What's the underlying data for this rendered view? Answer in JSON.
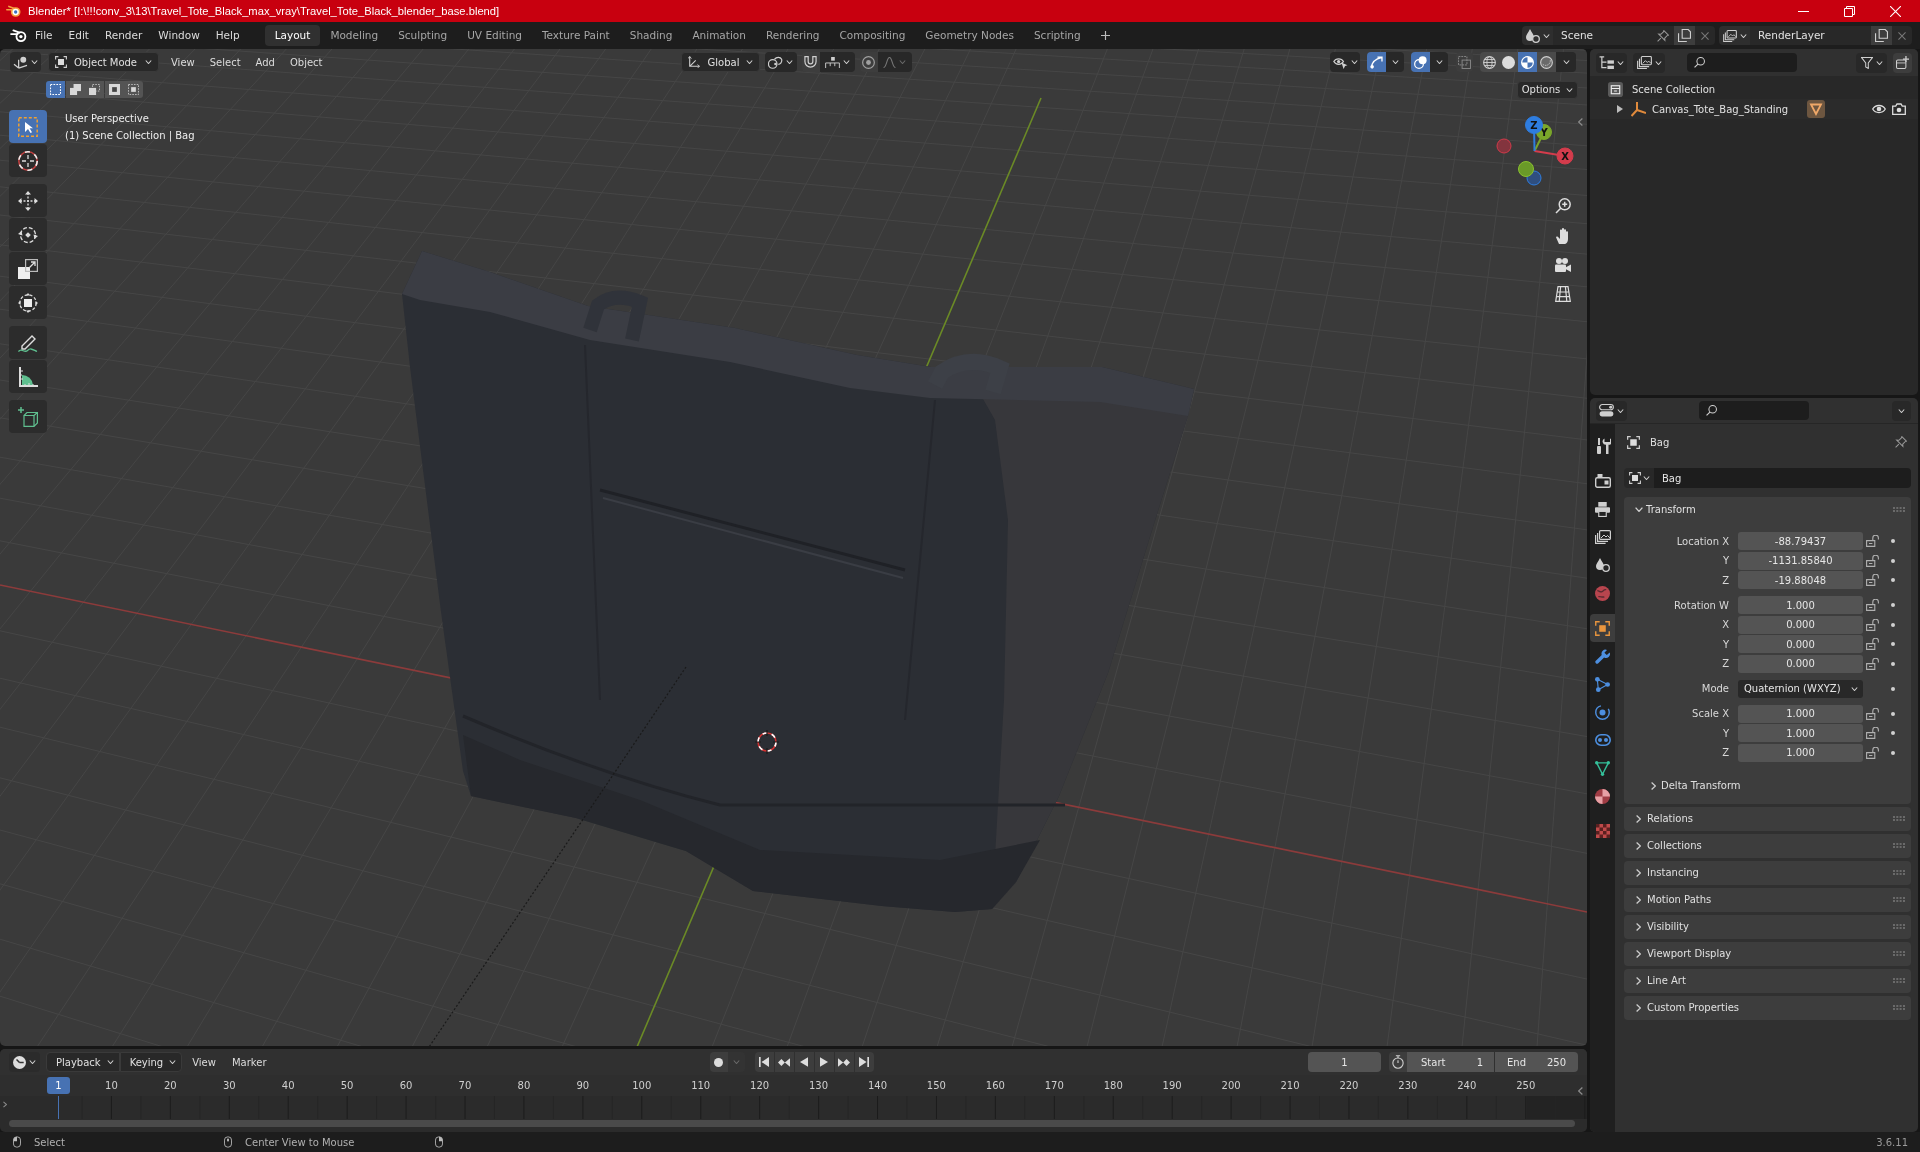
{
  "window": {
    "title": "Blender* [I:\\!!!conv_3\\13\\Travel_Tote_Black_max_vray\\Travel_Tote_Black_blender_base.blend]"
  },
  "top_bar": {
    "menus": [
      "File",
      "Edit",
      "Render",
      "Window",
      "Help"
    ],
    "workspaces": [
      {
        "label": "Layout",
        "selected": true
      },
      {
        "label": "Modeling",
        "selected": false
      },
      {
        "label": "Sculpting",
        "selected": false
      },
      {
        "label": "UV Editing",
        "selected": false
      },
      {
        "label": "Texture Paint",
        "selected": false
      },
      {
        "label": "Shading",
        "selected": false
      },
      {
        "label": "Animation",
        "selected": false
      },
      {
        "label": "Rendering",
        "selected": false
      },
      {
        "label": "Compositing",
        "selected": false
      },
      {
        "label": "Geometry Nodes",
        "selected": false
      },
      {
        "label": "Scripting",
        "selected": false
      }
    ],
    "scene": "Scene",
    "view_layer": "RenderLayer"
  },
  "viewport": {
    "header": {
      "mode": "Object Mode",
      "menus": [
        "View",
        "Select",
        "Add",
        "Object"
      ],
      "orientation": "Global",
      "toggles": {
        "snap": false,
        "proportional": false,
        "gizmos": true,
        "overlays": true,
        "xray": false
      },
      "shading": [
        {
          "kind": "wireframe",
          "selected": false
        },
        {
          "kind": "solid",
          "selected": false
        },
        {
          "kind": "material",
          "selected": true
        },
        {
          "kind": "rendered",
          "selected": false
        }
      ]
    },
    "select_modes": [
      {
        "kind": "set",
        "selected": true
      },
      {
        "kind": "extend",
        "selected": false
      },
      {
        "kind": "subtract",
        "selected": false
      },
      {
        "kind": "difference",
        "selected": false
      },
      {
        "kind": "intersect",
        "selected": false
      }
    ],
    "options": "Options",
    "tool_groups": [
      {
        "tools": [
          {
            "kind": "select_box",
            "selected": true
          },
          {
            "kind": "cursor",
            "selected": false
          }
        ]
      },
      {
        "tools": [
          {
            "kind": "move",
            "selected": false
          },
          {
            "kind": "rotate",
            "selected": false
          },
          {
            "kind": "scale",
            "selected": false
          },
          {
            "kind": "transform",
            "selected": false
          }
        ]
      },
      {
        "tools": [
          {
            "kind": "annotate",
            "selected": false
          },
          {
            "kind": "measure",
            "selected": false
          }
        ]
      },
      {
        "tools": [
          {
            "kind": "add_cube",
            "selected": false
          }
        ]
      }
    ],
    "info": [
      "User Perspective",
      "(1) Scene Collection | Bag"
    ],
    "gizmo_axes": [
      "X",
      "Y",
      "Z"
    ]
  },
  "outliner": {
    "tree": [
      {
        "kind": "collection",
        "label": "Scene Collection",
        "children": [
          {
            "kind": "object",
            "label": "Canvas_Tote_Bag_Standing",
            "expanded": false
          }
        ]
      }
    ]
  },
  "properties": {
    "tab_groups": [
      {
        "tabs": [
          {
            "kind": "tool",
            "selected": false
          }
        ]
      },
      {
        "tabs": [
          {
            "kind": "render",
            "selected": false
          },
          {
            "kind": "output",
            "selected": false
          },
          {
            "kind": "view_layer",
            "selected": false
          },
          {
            "kind": "scene",
            "selected": false
          },
          {
            "kind": "world",
            "selected": false
          }
        ]
      },
      {
        "tabs": [
          {
            "kind": "object",
            "selected": true
          },
          {
            "kind": "modifiers",
            "selected": false
          },
          {
            "kind": "particles",
            "selected": false
          },
          {
            "kind": "physics",
            "selected": false
          },
          {
            "kind": "constraints",
            "selected": false
          },
          {
            "kind": "data",
            "selected": false
          },
          {
            "kind": "material",
            "selected": false
          }
        ]
      },
      {
        "tabs": [
          {
            "kind": "texture",
            "selected": false
          }
        ]
      }
    ],
    "context": "Bag",
    "name": "Bag",
    "panels": [
      {
        "title": "Transform",
        "expanded": true,
        "groups": [
          {
            "rows": [
              {
                "kind": "number",
                "label": "Location X",
                "value": "-88.79437"
              },
              {
                "kind": "number",
                "label": "Y",
                "value": "-1131.85840"
              },
              {
                "kind": "number",
                "label": "Z",
                "value": "-19.88048"
              }
            ]
          },
          {
            "rows": [
              {
                "kind": "number",
                "label": "Rotation W",
                "value": "1.000"
              },
              {
                "kind": "number",
                "label": "X",
                "value": "0.000"
              },
              {
                "kind": "number",
                "label": "Y",
                "value": "0.000"
              },
              {
                "kind": "number",
                "label": "Z",
                "value": "0.000"
              }
            ]
          },
          {
            "rows": [
              {
                "kind": "dropdown",
                "label": "Mode",
                "value": "Quaternion (WXYZ)"
              }
            ]
          },
          {
            "rows": [
              {
                "kind": "number",
                "label": "Scale X",
                "value": "1.000"
              },
              {
                "kind": "number",
                "label": "Y",
                "value": "1.000"
              },
              {
                "kind": "number",
                "label": "Z",
                "value": "1.000"
              }
            ]
          }
        ],
        "subpanels": [
          {
            "title": "Delta Transform",
            "expanded": false
          }
        ]
      },
      {
        "title": "Relations",
        "expanded": false
      },
      {
        "title": "Collections",
        "expanded": false
      },
      {
        "title": "Instancing",
        "expanded": false
      },
      {
        "title": "Motion Paths",
        "expanded": false
      },
      {
        "title": "Visibility",
        "expanded": false
      },
      {
        "title": "Viewport Display",
        "expanded": false
      },
      {
        "title": "Line Art",
        "expanded": false
      },
      {
        "title": "Custom Properties",
        "expanded": false
      }
    ]
  },
  "timeline": {
    "menus": [
      {
        "kind": "dropdown",
        "label": "Playback"
      },
      {
        "kind": "dropdown",
        "label": "Keying"
      },
      {
        "kind": "menu",
        "label": "View"
      },
      {
        "kind": "menu",
        "label": "Marker"
      }
    ],
    "current_frame": "1",
    "start_label": "Start",
    "start": "1",
    "end_label": "End",
    "end": "250",
    "playhead": "1",
    "ticks": [
      "10",
      "20",
      "30",
      "40",
      "50",
      "60",
      "70",
      "80",
      "90",
      "100",
      "110",
      "120",
      "130",
      "140",
      "150",
      "160",
      "170",
      "180",
      "190",
      "200",
      "210",
      "220",
      "230",
      "240",
      "250"
    ]
  },
  "status_bar": {
    "hints": [
      "Select",
      "Center View to Mouse"
    ],
    "version": "3.6.11"
  }
}
